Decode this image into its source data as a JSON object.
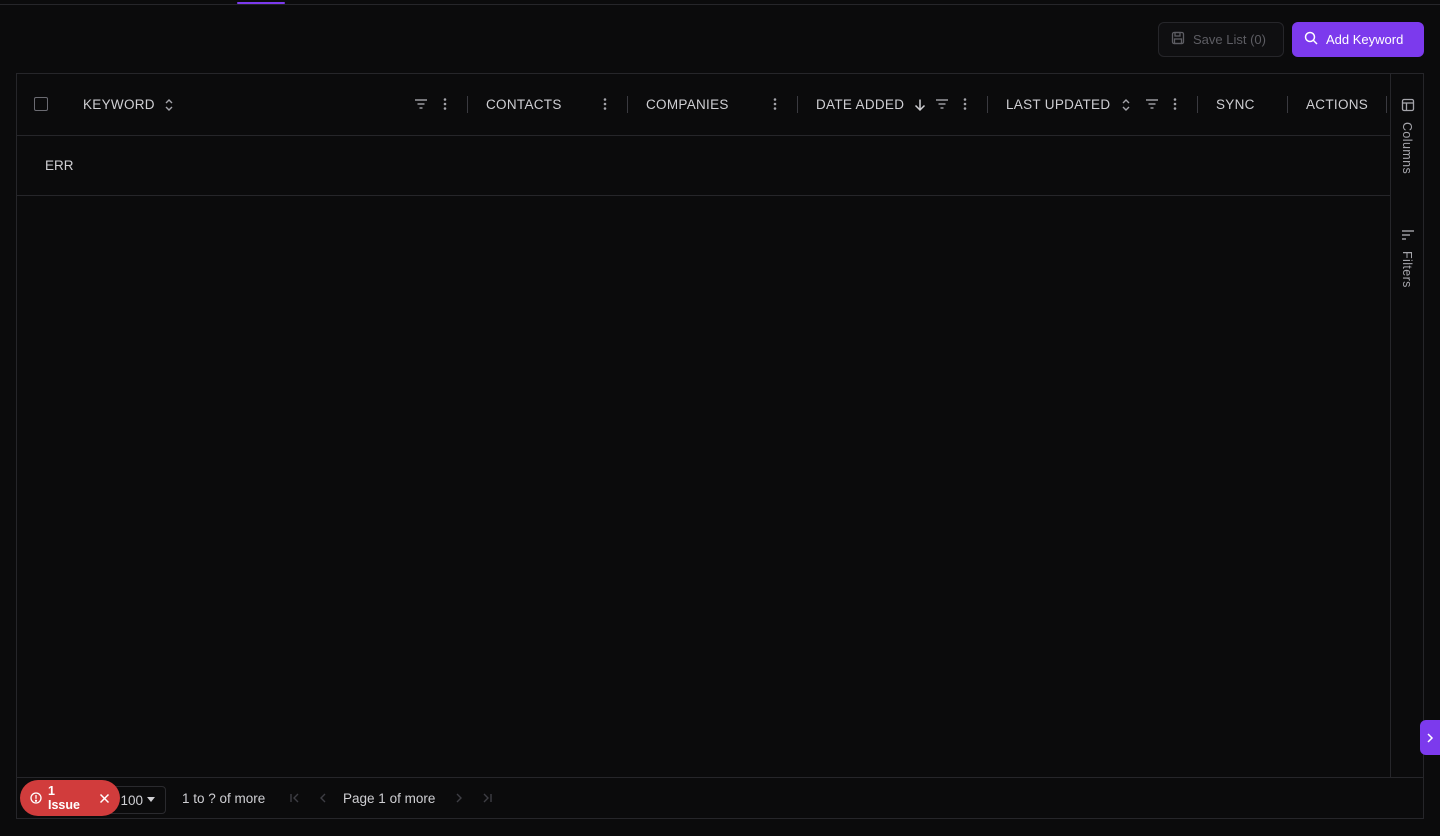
{
  "toolbar": {
    "save_label": "Save List (0)",
    "add_label": "Add Keyword"
  },
  "grid": {
    "columns": {
      "keyword": "KEYWORD",
      "contacts": "CONTACTS",
      "companies": "COMPANIES",
      "date_added": "DATE ADDED",
      "last_updated": "LAST UPDATED",
      "sync": "SYNC",
      "actions": "ACTIONS"
    },
    "rows": [
      {
        "keyword": "ERR"
      }
    ]
  },
  "side_panel": {
    "columns_label": "Columns",
    "filters_label": "Filters"
  },
  "pagination": {
    "page_size": "100",
    "range_text": "1 to ? of more",
    "page_text_prefix": "Page",
    "page_number": "1",
    "page_text_suffix": "of more"
  },
  "issues": {
    "label": "1 Issue"
  },
  "colors": {
    "accent": "#7c3aed",
    "error": "#d13c3c",
    "background": "#0b0b0c"
  },
  "icons": [
    "save-icon",
    "search-icon",
    "sort-icon",
    "filter-icon",
    "menu-dots-icon",
    "arrow-down-icon",
    "columns-icon",
    "filters-icon",
    "alert-circle-icon",
    "close-icon",
    "caret-down-icon",
    "first-page-icon",
    "prev-page-icon",
    "next-page-icon",
    "last-page-icon",
    "chevron-right-icon"
  ]
}
